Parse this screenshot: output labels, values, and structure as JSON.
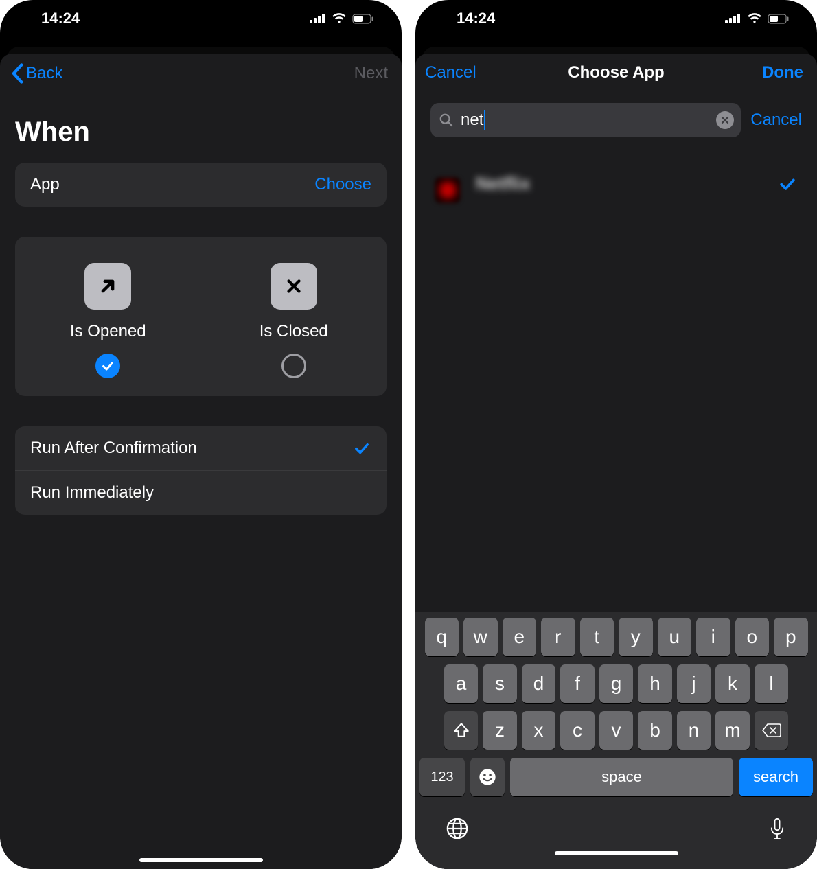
{
  "status": {
    "time": "14:24"
  },
  "screen1": {
    "nav": {
      "back": "Back",
      "next": "Next"
    },
    "section_title": "When",
    "app_row": {
      "label": "App",
      "action": "Choose"
    },
    "picker": {
      "opened": "Is Opened",
      "closed": "Is Closed"
    },
    "run": {
      "confirm": "Run After Confirmation",
      "immediate": "Run Immediately"
    }
  },
  "screen2": {
    "nav": {
      "cancel": "Cancel",
      "title": "Choose App",
      "done": "Done"
    },
    "search": {
      "value": "net",
      "cancel": "Cancel"
    },
    "result": {
      "name": "Netflix"
    },
    "keyboard": {
      "row1": [
        "q",
        "w",
        "e",
        "r",
        "t",
        "y",
        "u",
        "i",
        "o",
        "p"
      ],
      "row2": [
        "a",
        "s",
        "d",
        "f",
        "g",
        "h",
        "j",
        "k",
        "l"
      ],
      "row3": [
        "z",
        "x",
        "c",
        "v",
        "b",
        "n",
        "m"
      ],
      "num": "123",
      "space": "space",
      "search": "search"
    }
  }
}
